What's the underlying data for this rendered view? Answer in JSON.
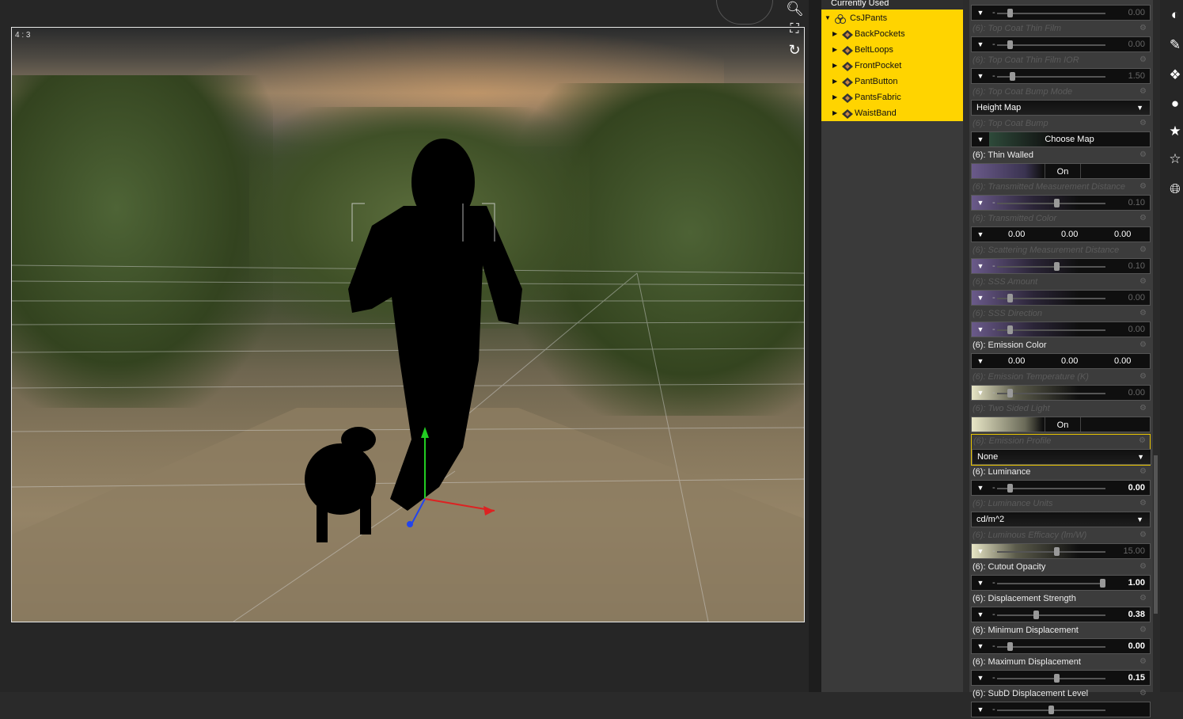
{
  "viewport": {
    "frame_ratio": "4 : 3",
    "tools": [
      "zoom-icon",
      "frame-icon",
      "orbit-icon"
    ]
  },
  "content_tree": {
    "header": "Currently Used",
    "root": "CsJPants",
    "items": [
      "BackPockets",
      "BeltLoops",
      "FrontPocket",
      "PantButton",
      "PantsFabric",
      "WaistBand"
    ],
    "highlight_color": "#ffd400"
  },
  "properties": [
    {
      "title": "",
      "type": "slider",
      "value": "0.00",
      "dim": true
    },
    {
      "title": "(6): Top Coat Thin Film",
      "type": "slider",
      "value": "0.00",
      "dim": true
    },
    {
      "title": "(6): Top Coat Thin Film IOR",
      "type": "slider",
      "value": "1.50",
      "dim": true
    },
    {
      "title": "(6): Top Coat Bump Mode",
      "type": "select",
      "value": "Height Map",
      "dim": true
    },
    {
      "title": "(6): Top Coat Bump",
      "type": "map",
      "value": "Choose Map",
      "dim": true
    },
    {
      "title": "(6): Thin Walled",
      "type": "toggle",
      "value": "On",
      "dim": false
    },
    {
      "title": "(6): Transmitted Measurement Distance",
      "type": "slider",
      "value": "0.10",
      "dim": true
    },
    {
      "title": "(6): Transmitted Color",
      "type": "color",
      "values": [
        "0.00",
        "0.00",
        "0.00"
      ],
      "dim": true
    },
    {
      "title": "(6): Scattering Measurement Distance",
      "type": "slider",
      "value": "0.10",
      "dim": true
    },
    {
      "title": "(6): SSS Amount",
      "type": "slider",
      "value": "0.00",
      "dim": true
    },
    {
      "title": "(6): SSS Direction",
      "type": "slider",
      "value": "0.00",
      "dim": true
    },
    {
      "title": "(6): Emission Color",
      "type": "color",
      "values": [
        "0.00",
        "0.00",
        "0.00"
      ],
      "dim": false
    },
    {
      "title": "(6): Emission Temperature (K)",
      "type": "slider",
      "value": "0.00",
      "dim": true
    },
    {
      "title": "(6): Two Sided Light",
      "type": "toggle",
      "value": "On",
      "dim": true
    },
    {
      "title": "(6): Emission Profile",
      "type": "select",
      "value": "None",
      "dim": true
    },
    {
      "title": "(6): Luminance",
      "type": "slider",
      "value": "0.00",
      "dim": false
    },
    {
      "title": "(6): Luminance Units",
      "type": "select",
      "value": "cd/m^2",
      "dim": true
    },
    {
      "title": "(6): Luminous Efficacy (lm/W)",
      "type": "slider",
      "value": "15.00",
      "dim": true
    },
    {
      "title": "(6): Cutout Opacity",
      "type": "slider",
      "value": "1.00",
      "dim": false
    },
    {
      "title": "(6): Displacement Strength",
      "type": "slider",
      "value": "0.38",
      "dim": false
    },
    {
      "title": "(6): Minimum Displacement",
      "type": "slider",
      "value": "0.00",
      "dim": false
    },
    {
      "title": "(6): Maximum Displacement",
      "type": "slider",
      "value": "0.15",
      "dim": false
    },
    {
      "title": "(6): SubD Displacement Level",
      "type": "slider",
      "value": "",
      "dim": false
    }
  ],
  "right_toolbar": [
    "sphere-icon",
    "surface-icon",
    "pose-icon",
    "figure-icon",
    "morph-icon",
    "shape-icon",
    "globe-icon"
  ]
}
